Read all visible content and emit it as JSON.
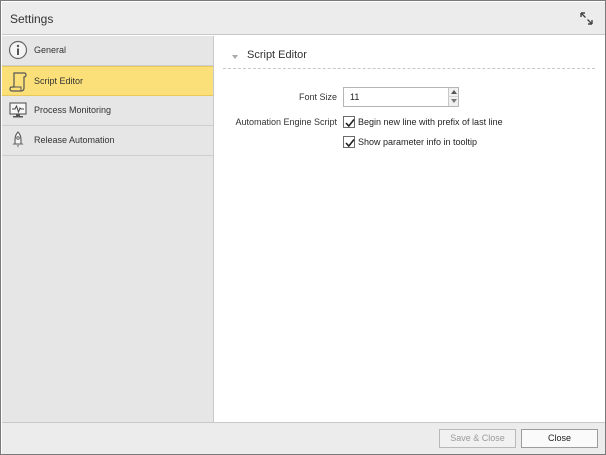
{
  "window": {
    "title": "Settings"
  },
  "sidebar": {
    "items": [
      {
        "label": "General",
        "icon": "info-icon",
        "selected": false
      },
      {
        "label": "Script Editor",
        "icon": "script-scroll-icon",
        "selected": true
      },
      {
        "label": "Process Monitoring",
        "icon": "monitor-pulse-icon",
        "selected": false
      },
      {
        "label": "Release Automation",
        "icon": "rocket-icon",
        "selected": false
      }
    ]
  },
  "content": {
    "section_title": "Script Editor",
    "font_size": {
      "label": "Font Size",
      "value": "11"
    },
    "automation_engine": {
      "label": "Automation Engine Script",
      "options": [
        {
          "label": "Begin new line with prefix of last line",
          "checked": true
        },
        {
          "label": "Show parameter info in tooltip",
          "checked": true
        }
      ]
    }
  },
  "footer": {
    "save_close_label": "Save & Close",
    "close_label": "Close"
  },
  "colors": {
    "selected_bg": "#fbe07a",
    "sidebar_bg": "#e6e6e6",
    "titlebar_bg": "#ececec"
  }
}
